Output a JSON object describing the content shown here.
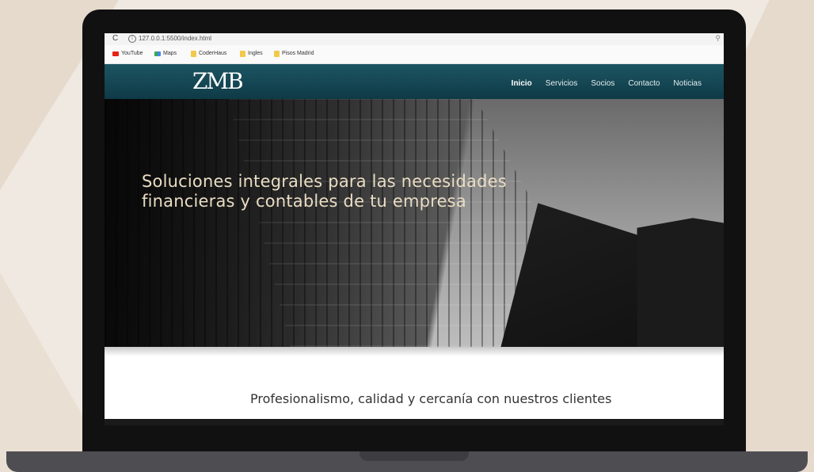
{
  "browser": {
    "url": "127.0.0.1:5500/index.html",
    "bookmarks": [
      {
        "label": "YouTube",
        "icon": "youtube-icon"
      },
      {
        "label": "Maps",
        "icon": "maps-icon"
      },
      {
        "label": "CoderHaus",
        "icon": "folder-icon"
      },
      {
        "label": "Ingles",
        "icon": "folder-icon"
      },
      {
        "label": "Pisos Madrid",
        "icon": "folder-icon"
      }
    ]
  },
  "site": {
    "logo": "ZMB",
    "nav": [
      "Inicio",
      "Servicios",
      "Socios",
      "Contacto",
      "Noticias"
    ],
    "active_nav": "Inicio",
    "hero_heading": "Soluciones integrales para las necesidades financieras y contables de tu empresa",
    "tagline": "Profesionalismo, calidad y cercanía con nuestros clientes"
  },
  "colors": {
    "nav_bg": "#1c5563",
    "hero_text": "#e9dcc3",
    "page_bg": "#f0e9e2"
  }
}
